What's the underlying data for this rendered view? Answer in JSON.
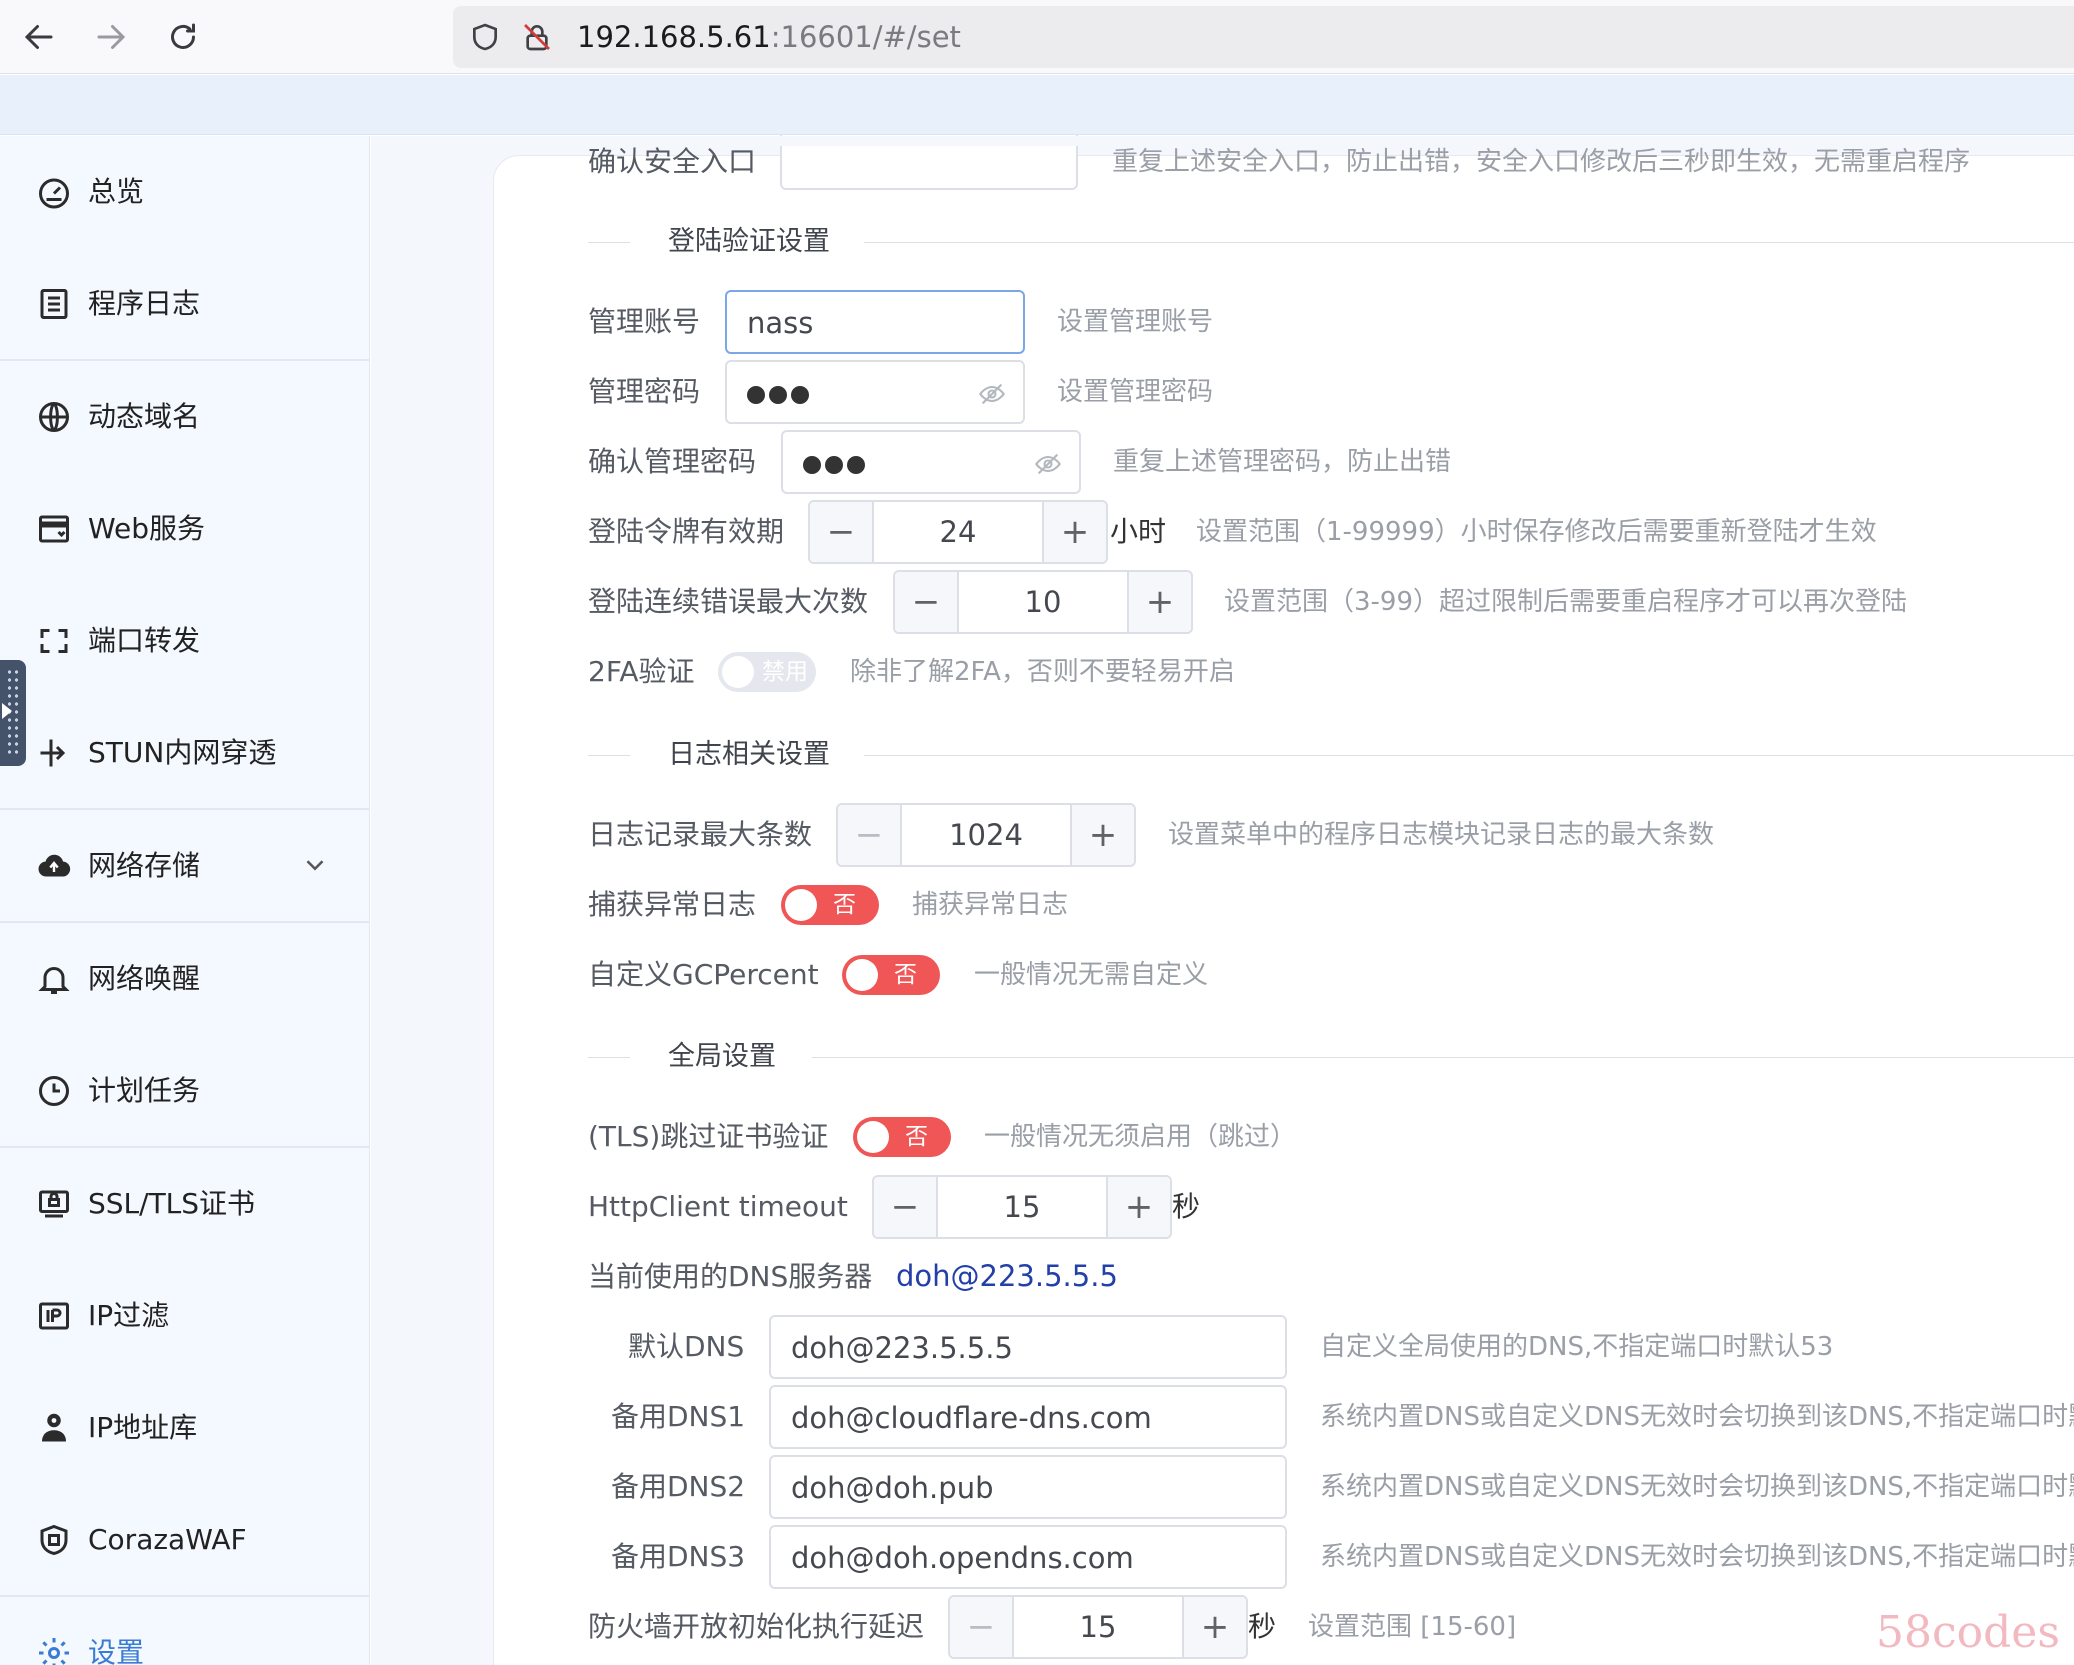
{
  "browser": {
    "url_host": "192.168.5.61",
    "url_rest": ":16601/#/set"
  },
  "sidebar": {
    "items": [
      {
        "label": "总览"
      },
      {
        "label": "程序日志"
      },
      {
        "label": "动态域名"
      },
      {
        "label": "Web服务"
      },
      {
        "label": "端口转发"
      },
      {
        "label": "STUN内网穿透"
      },
      {
        "label": "网络存储"
      },
      {
        "label": "网络唤醒"
      },
      {
        "label": "计划任务"
      },
      {
        "label": "SSL/TLS证书"
      },
      {
        "label": "IP过滤"
      },
      {
        "label": "IP地址库"
      },
      {
        "label": "CorazaWAF"
      },
      {
        "label": "设置"
      }
    ]
  },
  "top_row": {
    "label": "确认安全入口",
    "hint": "重复上述安全入口，防止出错，安全入口修改后三秒即生效，无需重启程序"
  },
  "login_section": {
    "title": "登陆验证设置",
    "admin_account": {
      "label": "管理账号",
      "value": "nass",
      "hint": "设置管理账号"
    },
    "admin_password": {
      "label": "管理密码",
      "hint": "设置管理密码"
    },
    "confirm_password": {
      "label": "确认管理密码",
      "hint": "重复上述管理密码，防止出错"
    },
    "token_validity": {
      "label": "登陆令牌有效期",
      "value": "24",
      "unit": "小时",
      "hint": "设置范围（1-99999）小时保存修改后需要重新登陆才生效"
    },
    "max_errors": {
      "label": "登陆连续错误最大次数",
      "value": "10",
      "hint": "设置范围（3-99）超过限制后需要重启程序才可以再次登陆"
    },
    "twofa": {
      "label": "2FA验证",
      "switch_text": "禁用",
      "hint": "除非了解2FA，否则不要轻易开启"
    }
  },
  "log_section": {
    "title": "日志相关设置",
    "max_records": {
      "label": "日志记录最大条数",
      "value": "1024",
      "hint": "设置菜单中的程序日志模块记录日志的最大条数"
    },
    "capture_errors": {
      "label": "捕获异常日志",
      "switch_text": "否",
      "hint": "捕获异常日志"
    },
    "gcpercent": {
      "label": "自定义GCPercent",
      "switch_text": "否",
      "hint": "一般情况无需自定义"
    }
  },
  "global_section": {
    "title": "全局设置",
    "tls_skip": {
      "label": "(TLS)跳过证书验证",
      "switch_text": "否",
      "hint": "一般情况无须启用（跳过）"
    },
    "http_timeout": {
      "label": "HttpClient timeout",
      "value": "15",
      "unit": "秒"
    },
    "current_dns": {
      "label": "当前使用的DNS服务器",
      "value": "doh@223.5.5.5"
    },
    "default_dns": {
      "label": "默认DNS",
      "value": "doh@223.5.5.5",
      "hint": "自定义全局使用的DNS,不指定端口时默认53"
    },
    "backup_dns1": {
      "label": "备用DNS1",
      "value": "doh@cloudflare-dns.com",
      "hint": "系统内置DNS或自定义DNS无效时会切换到该DNS,不指定端口时默"
    },
    "backup_dns2": {
      "label": "备用DNS2",
      "value": "doh@doh.pub",
      "hint": "系统内置DNS或自定义DNS无效时会切换到该DNS,不指定端口时默"
    },
    "backup_dns3": {
      "label": "备用DNS3",
      "value": "doh@doh.opendns.com",
      "hint": "系统内置DNS或自定义DNS无效时会切换到该DNS,不指定端口时默"
    },
    "firewall_delay": {
      "label": "防火墙开放初始化执行延迟",
      "value": "15",
      "unit": "秒",
      "hint": "设置范围 [15-60]"
    }
  },
  "watermark": "58codes"
}
